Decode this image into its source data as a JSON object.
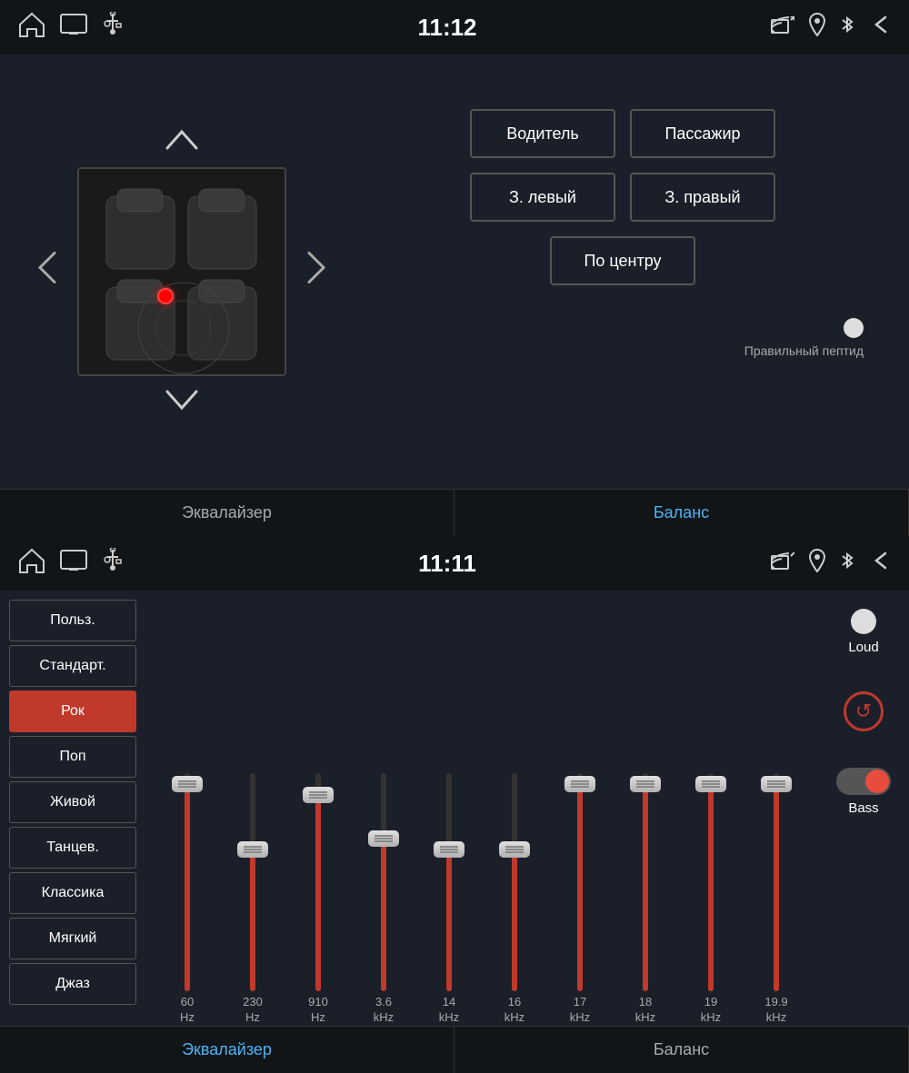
{
  "top": {
    "statusBar": {
      "time": "11:12"
    },
    "speakerSection": {
      "upArrow": "▲",
      "downArrow": "▼",
      "leftArrow": "❮",
      "rightArrow": "❯"
    },
    "buttons": {
      "driver": "Водитель",
      "passenger": "Пассажир",
      "rearLeft": "З. левый",
      "rearRight": "З. правый",
      "center": "По центру",
      "balanceLabel": "Правильный пептид"
    },
    "tabs": {
      "equalizer": "Эквалайзер",
      "balance": "Баланс",
      "activeTab": "balance"
    }
  },
  "bottom": {
    "statusBar": {
      "time": "11:11"
    },
    "presets": [
      {
        "id": "user",
        "label": "Польз.",
        "active": false
      },
      {
        "id": "standard",
        "label": "Стандарт.",
        "active": false
      },
      {
        "id": "rock",
        "label": "Рок",
        "active": true
      },
      {
        "id": "pop",
        "label": "Поп",
        "active": false
      },
      {
        "id": "live",
        "label": "Живой",
        "active": false
      },
      {
        "id": "dance",
        "label": "Танцев.",
        "active": false
      },
      {
        "id": "classic",
        "label": "Классика",
        "active": false
      },
      {
        "id": "soft",
        "label": "Мягкий",
        "active": false
      },
      {
        "id": "jazz",
        "label": "Джаз",
        "active": false
      }
    ],
    "sliders": [
      {
        "freq": "60",
        "unit": "Hz",
        "fillPercent": 95
      },
      {
        "freq": "230",
        "unit": "Hz",
        "fillPercent": 65
      },
      {
        "freq": "910",
        "unit": "Hz",
        "fillPercent": 90
      },
      {
        "freq": "3.6",
        "unit": "kHz",
        "fillPercent": 70
      },
      {
        "freq": "14",
        "unit": "kHz",
        "fillPercent": 65
      },
      {
        "freq": "16",
        "unit": "kHz",
        "fillPercent": 65
      },
      {
        "freq": "17",
        "unit": "kHz",
        "fillPercent": 95
      },
      {
        "freq": "18",
        "unit": "kHz",
        "fillPercent": 95
      },
      {
        "freq": "19",
        "unit": "kHz",
        "fillPercent": 95
      },
      {
        "freq": "19.9",
        "unit": "kHz",
        "fillPercent": 95
      }
    ],
    "controls": {
      "loudLabel": "Loud",
      "bassLabel": "Bass",
      "resetLabel": "↺"
    },
    "tabs": {
      "equalizer": "Эквалайзер",
      "balance": "Баланс",
      "activeTab": "equalizer"
    }
  }
}
